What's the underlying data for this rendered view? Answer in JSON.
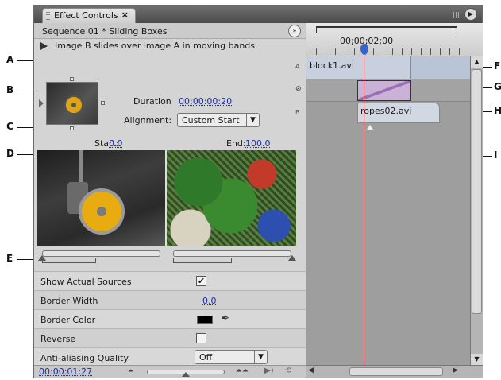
{
  "callouts": {
    "a": "A",
    "b": "B",
    "c": "C",
    "d": "D",
    "e": "E",
    "f": "F",
    "g": "G",
    "h": "H",
    "i": "I"
  },
  "panel": {
    "tab_label": "Effect Controls",
    "tab_close": "×",
    "menu_icon": "panel-menu-icon"
  },
  "effect": {
    "sequence_title": "Sequence 01 * Sliding Boxes",
    "sequence_btn": "»",
    "description": "Image B slides over image A in moving bands.",
    "duration_label": "Duration",
    "duration_value": "00:00:00:20",
    "alignment_label": "Alignment:",
    "alignment_value": "Custom Start",
    "start_label": "Start:",
    "start_value": "0.0",
    "end_label": "End:",
    "end_value": "100.0"
  },
  "properties": [
    {
      "label": "Show Actual Sources",
      "type": "checkbox",
      "checked": true
    },
    {
      "label": "Border Width",
      "type": "number",
      "value": "0.0"
    },
    {
      "label": "Border Color",
      "type": "color",
      "value": "#000000"
    },
    {
      "label": "Reverse",
      "type": "checkbox",
      "checked": false
    },
    {
      "label": "Anti-aliasing Quality",
      "type": "select",
      "value": "Off"
    }
  ],
  "status": {
    "timecode": "00:00:01:27"
  },
  "timeline": {
    "ruler_time": "00;00;02;00",
    "track_a_letter": "A",
    "transition_letter": "⊘",
    "track_b_letter": "B",
    "clip_a": "block1.avi",
    "clip_b": "ropes02.avi"
  },
  "colors": {
    "playhead": "#d0202a",
    "value_link": "#1d2fa8",
    "transition": "#c9b2d6"
  }
}
